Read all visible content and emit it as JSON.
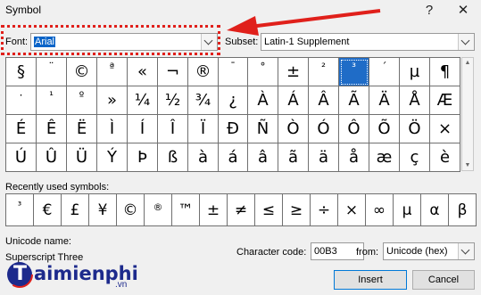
{
  "window": {
    "title": "Symbol",
    "help_glyph": "?",
    "close_glyph": "✕"
  },
  "font": {
    "label": "Font:",
    "value": "Arial"
  },
  "subset": {
    "label": "Subset:",
    "value": "Latin-1 Supplement"
  },
  "symbols": [
    "§",
    "¨",
    "©",
    "ª",
    "«",
    "¬",
    "®",
    "¯",
    "°",
    "±",
    "²",
    "³",
    "´",
    "µ",
    "¶",
    "·",
    "¹",
    "º",
    "»",
    "¼",
    "½",
    "¾",
    "¿",
    "À",
    "Á",
    "Â",
    "Ã",
    "Ä",
    "Å",
    "Æ",
    "É",
    "Ê",
    "Ë",
    "Ì",
    "Í",
    "Î",
    "Ï",
    "Ð",
    "Ñ",
    "Ò",
    "Ó",
    "Ô",
    "Õ",
    "Ö",
    "×",
    "Ú",
    "Û",
    "Ü",
    "Ý",
    "Þ",
    "ß",
    "à",
    "á",
    "â",
    "ã",
    "ä",
    "å",
    "æ",
    "ç",
    "è"
  ],
  "selected_symbol_index": 11,
  "recent": {
    "label": "Recently used symbols:",
    "items": [
      "³",
      "€",
      "£",
      "¥",
      "©",
      "®",
      "™",
      "±",
      "≠",
      "≤",
      "≥",
      "÷",
      "×",
      "∞",
      "µ",
      "α",
      "β"
    ]
  },
  "unicode_name": {
    "label": "Unicode name:",
    "value": "Superscript Three"
  },
  "char_code": {
    "label": "Character code:",
    "value": "00B3"
  },
  "from": {
    "label": "from:",
    "value": "Unicode (hex)"
  },
  "buttons": {
    "insert": "Insert",
    "cancel": "Cancel"
  },
  "watermark": {
    "letter": "T",
    "text": "aimienphi",
    "suffix": ".vn"
  },
  "colors": {
    "annotation": "#e0201b",
    "selected": "#1f6cc7",
    "watermark": "#1d2a8c"
  }
}
